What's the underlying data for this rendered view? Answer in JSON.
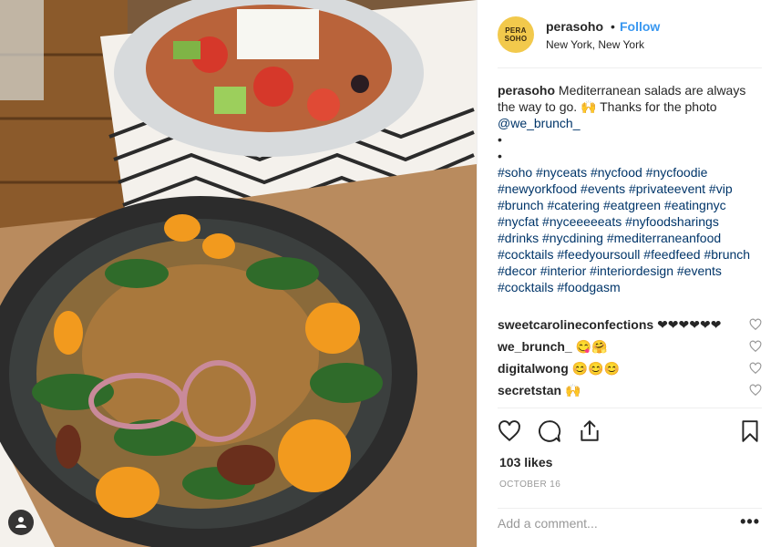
{
  "post": {
    "username": "perasoho",
    "follow_label": "Follow",
    "separator": "•",
    "location": "New York, New York",
    "avatar_text_line1": "PERA",
    "avatar_text_line2": "SOHO"
  },
  "caption": {
    "username": "perasoho",
    "text": "Mediterranean salads are always the way to go. 🙌 Thanks for the photo",
    "mention": "@we_brunch_",
    "bullet1": "•",
    "bullet2": "•",
    "hashtags": "#soho #nyceats #nycfood #nycfoodie #newyorkfood #events #privateevent #vip #brunch #catering #eatgreen #eatingnyc #nycfat #nyceeeeeats #nyfoodsharings #drinks #nycdining #mediterraneanfood #cocktails #feedyoursoull #feedfeed #brunch #decor #interior #interiordesign #events #cocktails #foodgasm"
  },
  "comments": [
    {
      "user": "sweetcarolineconfections",
      "text": "❤❤❤❤❤❤"
    },
    {
      "user": "we_brunch_",
      "text": "😋🤗"
    },
    {
      "user": "digitalwong",
      "text": "😊😊😊"
    },
    {
      "user": "secretstan",
      "text": "🙌"
    }
  ],
  "actions": {
    "likes": "103 likes",
    "date": "OCTOBER 16"
  },
  "add_comment": {
    "placeholder": "Add a comment...",
    "more": "•••"
  }
}
